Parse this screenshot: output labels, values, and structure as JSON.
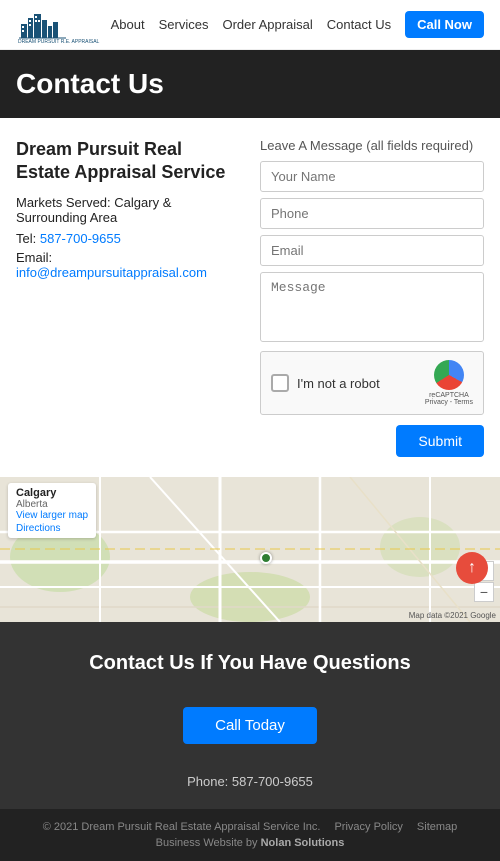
{
  "navbar": {
    "logo_alt": "Dream Pursuit R.E. Appraisal",
    "links": [
      {
        "label": "About",
        "href": "#"
      },
      {
        "label": "Services",
        "href": "#"
      },
      {
        "label": "Order Appraisal",
        "href": "#"
      },
      {
        "label": "Contact Us",
        "href": "#"
      }
    ],
    "cta_label": "Call Now"
  },
  "page_header": {
    "title": "Contact Us"
  },
  "left_col": {
    "business_name": "Dream Pursuit Real Estate Appraisal Service",
    "markets_label": "Markets Served:",
    "markets_value": "Calgary & Surrounding Area",
    "tel_label": "Tel:",
    "tel_value": "587-700-9655",
    "tel_href": "tel:5877009655",
    "email_label": "Email:",
    "email_value": "info@dreampursuitappraisal.com",
    "email_href": "mailto:info@dreampursuitappraisal.com"
  },
  "form": {
    "section_label": "Leave A Message (all fields required)",
    "name_placeholder": "Your Name",
    "phone_placeholder": "Phone",
    "email_placeholder": "Email",
    "message_placeholder": "Message",
    "recaptcha_text": "I'm not a robot",
    "recaptcha_brand": "reCAPTCHA",
    "recaptcha_sub": "Privacy - Terms",
    "submit_label": "Submit"
  },
  "map": {
    "city": "Calgary",
    "province": "Alberta",
    "directions_label": "Directions",
    "view_larger_label": "View larger map",
    "attribution": "Map data ©2021 Google"
  },
  "footer_cta": {
    "heading": "Contact Us If You Have Questions",
    "button_label": "Call Today",
    "phone_label": "Phone:",
    "phone_value": "587-700-9655"
  },
  "bottom_footer": {
    "copyright": "© 2021 Dream Pursuit Real Estate Appraisal Service Inc.",
    "privacy_label": "Privacy Policy",
    "sitemap_label": "Sitemap",
    "built_by": "Business Website by",
    "built_by_link": "Nolan Solutions"
  },
  "scroll_top": {
    "icon": "↑"
  }
}
